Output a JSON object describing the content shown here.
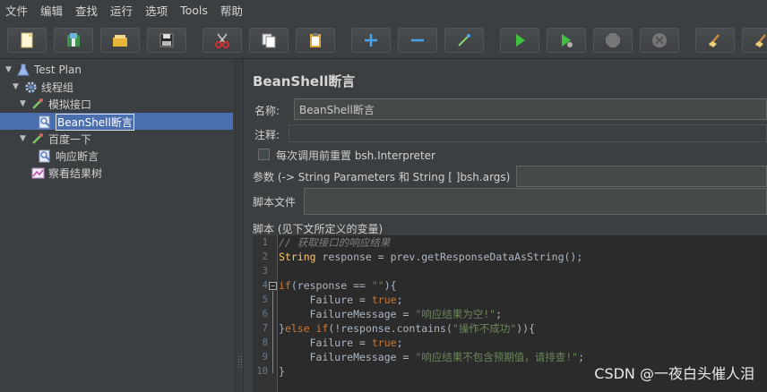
{
  "menu": [
    "文件",
    "编辑",
    "查找",
    "运行",
    "选项",
    "Tools",
    "帮助"
  ],
  "toolbar": {
    "buttons": [
      "new-icon",
      "templates-icon",
      "open-icon",
      "save-icon",
      "cut-icon",
      "copy-icon",
      "paste-icon",
      "expand-icon",
      "collapse-icon",
      "toggle-icon",
      "start-icon",
      "start-no-pause-icon",
      "stop-icon",
      "shutdown-icon",
      "clear-icon",
      "clear-all-icon"
    ]
  },
  "tree": {
    "items": [
      {
        "label": "Test Plan",
        "icon": "test-plan-icon"
      },
      {
        "label": "线程组",
        "icon": "gear-icon"
      },
      {
        "label": "模拟接口",
        "icon": "sampler-icon"
      },
      {
        "label": "BeanShell断言",
        "icon": "assertion-icon"
      },
      {
        "label": "百度一下",
        "icon": "sampler-icon"
      },
      {
        "label": "响应断言",
        "icon": "assertion-icon"
      },
      {
        "label": "察看结果树",
        "icon": "listener-icon"
      }
    ]
  },
  "panel": {
    "title": "BeanShell断言",
    "name_label": "名称:",
    "name_value": "BeanShell断言",
    "comment_label": "注释:",
    "comment_value": "",
    "reset_label": "每次调用前重置 bsh.Interpreter",
    "params_label": "参数 (-> String Parameters 和 String [ ]bsh.args)",
    "params_value": "",
    "script_file_label": "脚本文件",
    "script_file_value": "",
    "script_label": "脚本 (见下文所定义的变量)"
  },
  "code": {
    "line_numbers": [
      "1",
      "2",
      "3",
      "4",
      "5",
      "6",
      "7",
      "8",
      "9",
      "10"
    ],
    "lines": [
      "// 获取接口的响应结果",
      "String response = prev.getResponseDataAsString();",
      "",
      "if(response == \"\"){",
      "     Failure = true;",
      "     FailureMessage = \"响应结果为空!\";",
      "}else if(!response.contains(\"操作不成功\")){",
      "     Failure = true;",
      "     FailureMessage = \"响应结果不包含预期值，请排查!\";",
      "}"
    ]
  },
  "watermark": "CSDN @一夜白头催人泪"
}
